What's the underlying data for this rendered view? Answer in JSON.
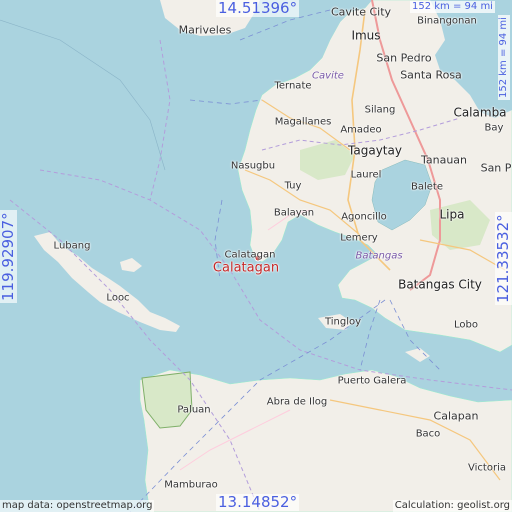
{
  "map": {
    "coords": {
      "top": "14.51396°",
      "bottom": "13.14852°",
      "left": "119.92907°",
      "right": "121.33532°"
    },
    "scale": {
      "top": "152 km = 94 mi",
      "right": "152 km = 94 mi"
    },
    "credits": {
      "left": "map data: openstreetmap.org",
      "right": "Calculation: geolist.org"
    },
    "marker_label": "Calatagan",
    "places": {
      "mariveles": "Mariveles",
      "cavite_city": "Cavite City",
      "binangonan": "Binangonan",
      "imus": "Imus",
      "san_pedro": "San Pedro",
      "cavite": "Cavite",
      "santa_rosa": "Santa Rosa",
      "ternate": "Ternate",
      "silang": "Silang",
      "calamba": "Calamba",
      "magallanes": "Magallanes",
      "amadeo": "Amadeo",
      "bay": "Bay",
      "tagaytay": "Tagaytay",
      "tanauan": "Tanauan",
      "nasugbu": "Nasugbu",
      "san_pablo": "San P",
      "laurel": "Laurel",
      "balete": "Balete",
      "tuy": "Tuy",
      "balayan": "Balayan",
      "agoncillo": "Agoncillo",
      "lipa": "Lipa",
      "lubang": "Lubang",
      "lemery": "Lemery",
      "batangas": "Batangas",
      "calatagan_town": "Calatagan",
      "looc": "Looc",
      "batangas_city": "Batangas City",
      "tingloy": "Tingloy",
      "lobo": "Lobo",
      "puerto_galera": "Puerto Galera",
      "abra_de_ilog": "Abra de Ilog",
      "paluan": "Paluan",
      "calapan": "Calapan",
      "baco": "Baco",
      "mamburao": "Mamburao",
      "victoria": "Victoria"
    }
  }
}
